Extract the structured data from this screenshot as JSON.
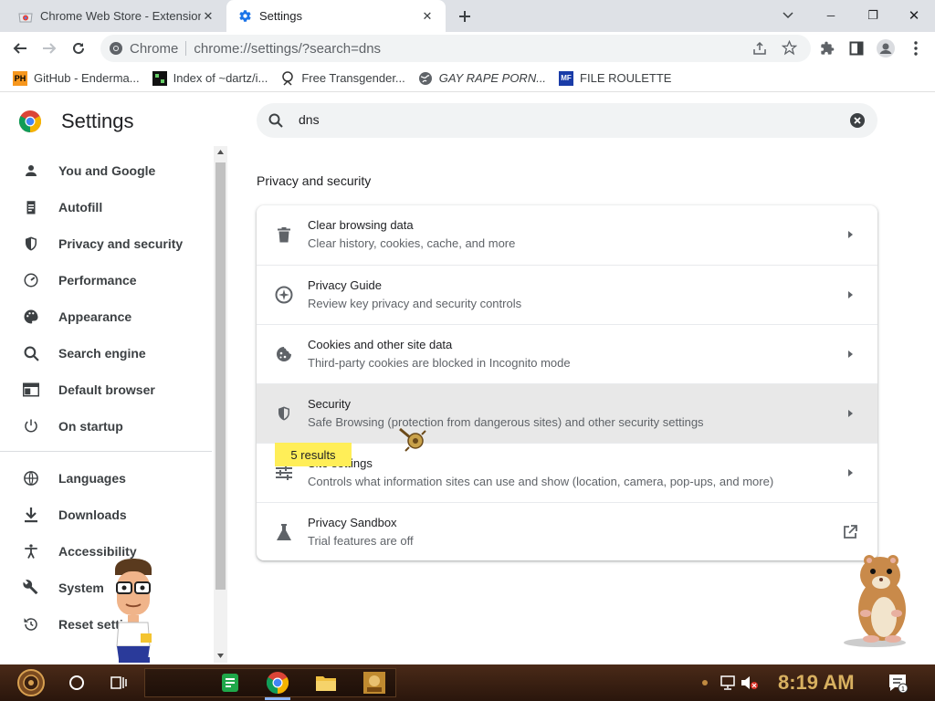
{
  "tabs": [
    {
      "title": "Chrome Web Store - Extensions",
      "close": "✕"
    },
    {
      "title": "Settings",
      "close": "✕"
    }
  ],
  "new_tab": "+",
  "window_controls": {
    "minimize": "─",
    "restore": "❐",
    "close": "✕"
  },
  "omnibox": {
    "label": "Chrome",
    "url": "chrome://settings/?search=dns"
  },
  "bookmarks": [
    {
      "label": "GitHub - Enderma...",
      "favicon": "PH"
    },
    {
      "label": "Index of ~dartz/i...",
      "favicon": ""
    },
    {
      "label": "Free Transgender...",
      "favicon": ""
    },
    {
      "label": "GAY RAPE PORN...",
      "favicon": ""
    },
    {
      "label": "FILE ROULETTE",
      "favicon": "MF"
    }
  ],
  "settings_title": "Settings",
  "search": {
    "value": "dns"
  },
  "sidebar": [
    {
      "label": "You and Google",
      "icon": "person-icon"
    },
    {
      "label": "Autofill",
      "icon": "clipboard-icon"
    },
    {
      "label": "Privacy and security",
      "icon": "shield-icon"
    },
    {
      "label": "Performance",
      "icon": "speedometer-icon"
    },
    {
      "label": "Appearance",
      "icon": "palette-icon"
    },
    {
      "label": "Search engine",
      "icon": "search-icon"
    },
    {
      "label": "Default browser",
      "icon": "browser-icon"
    },
    {
      "label": "On startup",
      "icon": "power-icon"
    },
    {
      "label": "Languages",
      "icon": "globe-icon"
    },
    {
      "label": "Downloads",
      "icon": "download-icon"
    },
    {
      "label": "Accessibility",
      "icon": "accessibility-icon"
    },
    {
      "label": "System",
      "icon": "wrench-icon"
    },
    {
      "label": "Reset settings",
      "icon": "reset-icon"
    }
  ],
  "section_title": "Privacy and security",
  "rows": [
    {
      "title": "Clear browsing data",
      "subtitle": "Clear history, cookies, cache, and more",
      "icon": "trash-icon"
    },
    {
      "title": "Privacy Guide",
      "subtitle": "Review key privacy and security controls",
      "icon": "compass-icon"
    },
    {
      "title": "Cookies and other site data",
      "subtitle": "Third-party cookies are blocked in Incognito mode",
      "icon": "cookie-icon"
    },
    {
      "title": "Security",
      "subtitle": "Safe Browsing (protection from dangerous sites) and other security settings",
      "icon": "shield-icon"
    },
    {
      "title": "Site settings",
      "subtitle": "Controls what information sites can use and show (location, camera, pop-ups, and more)",
      "icon": "sliders-icon"
    },
    {
      "title": "Privacy Sandbox",
      "subtitle": "Trial features are off",
      "icon": "flask-icon"
    }
  ],
  "results_tip": "5 results",
  "taskbar": {
    "clock": "8:19 AM"
  },
  "colors": {
    "accent": "#1a73e8",
    "tooltip": "#ffee58",
    "taskbar": "#3a2010"
  }
}
